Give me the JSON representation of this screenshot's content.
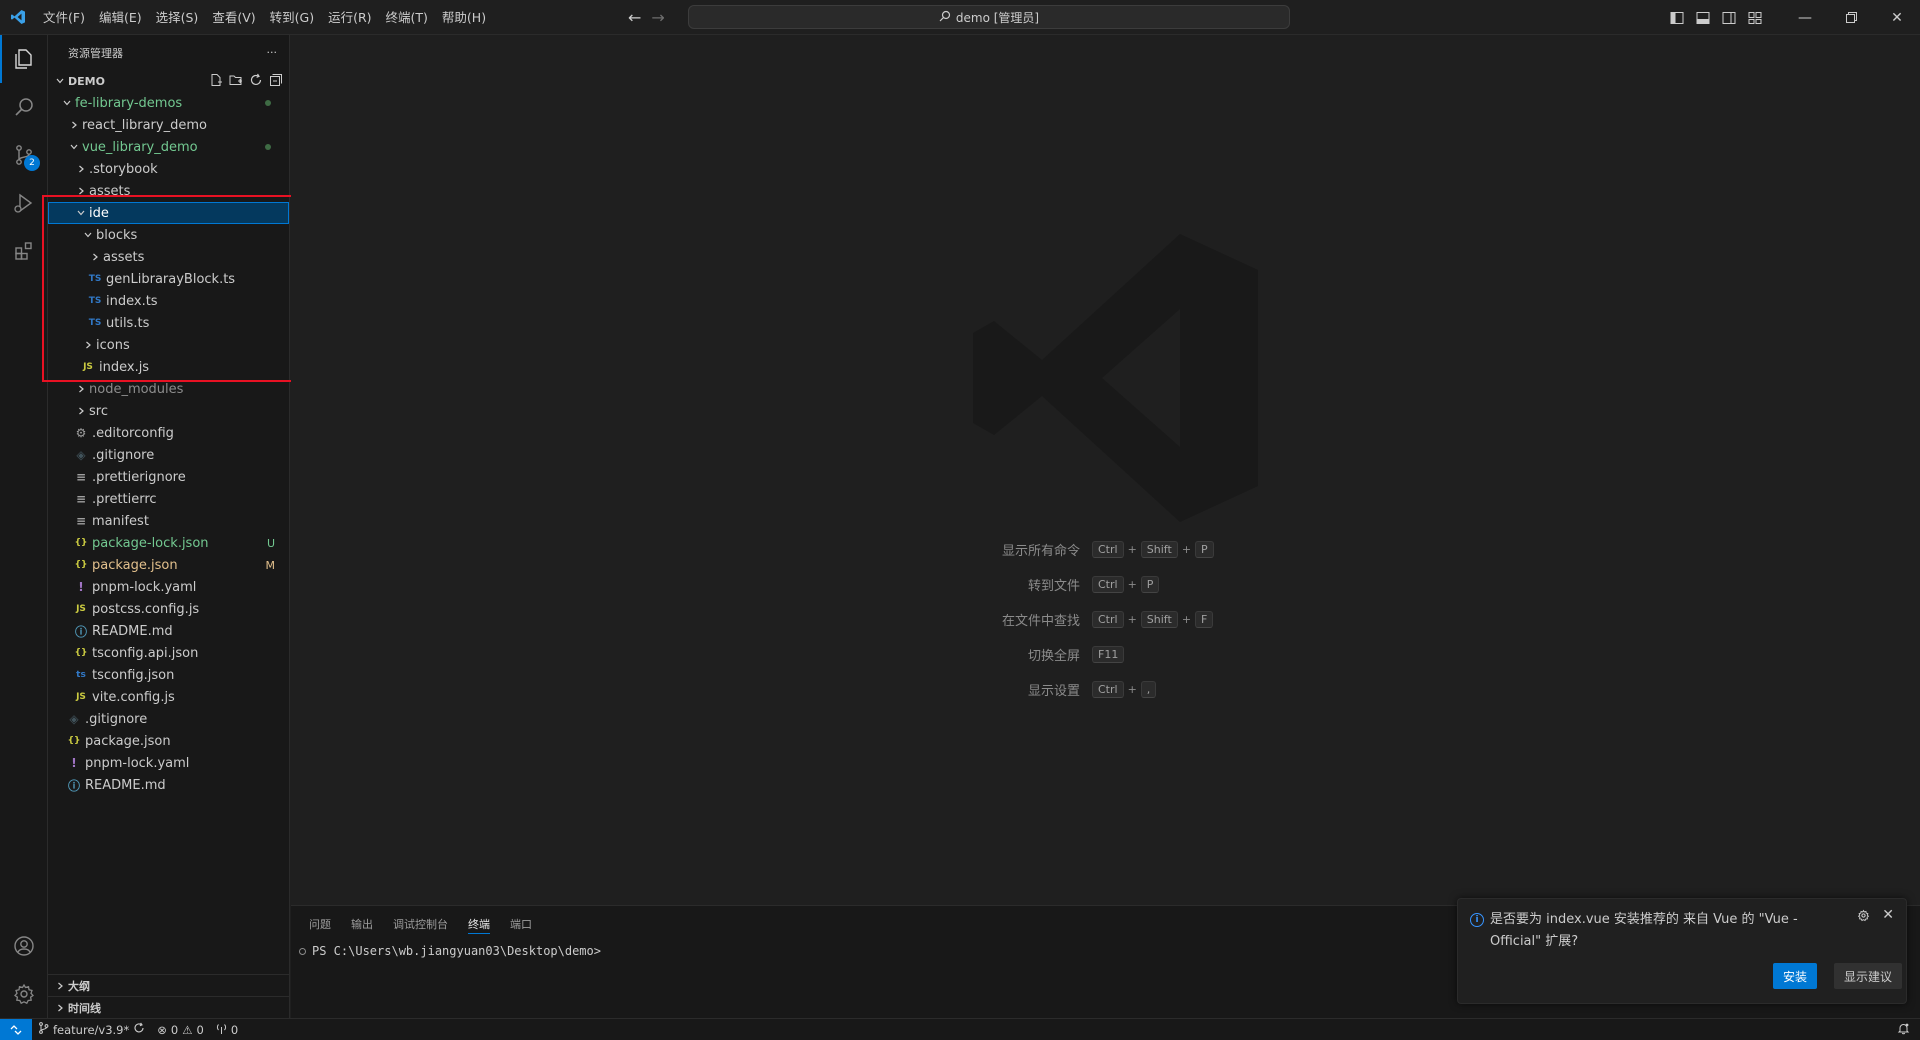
{
  "titlebar": {
    "menus": [
      "文件(F)",
      "编辑(E)",
      "选择(S)",
      "查看(V)",
      "转到(G)",
      "运行(R)",
      "终端(T)",
      "帮助(H)"
    ],
    "command_center": "demo [管理员]"
  },
  "activity": {
    "scm_badge": "2"
  },
  "sidebar": {
    "title": "资源管理器",
    "more": "···",
    "root": "DEMO",
    "tree": [
      {
        "label": "fe-library-demos",
        "indent": 1,
        "chev": "down",
        "icon": "",
        "color": "#73c991",
        "dot": true
      },
      {
        "label": "react_library_demo",
        "indent": 2,
        "chev": "right",
        "icon": "",
        "color": "#cccccc"
      },
      {
        "label": "vue_library_demo",
        "indent": 2,
        "chev": "down",
        "icon": "",
        "color": "#73c991",
        "dot": true
      },
      {
        "label": ".storybook",
        "indent": 3,
        "chev": "right",
        "icon": "",
        "color": "#cccccc"
      },
      {
        "label": "assets",
        "indent": 3,
        "chev": "right",
        "icon": "",
        "color": "#cccccc"
      },
      {
        "label": "ide",
        "indent": 3,
        "chev": "down",
        "icon": "",
        "color": "#ffffff",
        "selected": true
      },
      {
        "label": "blocks",
        "indent": 4,
        "chev": "down",
        "icon": "",
        "color": "#cccccc"
      },
      {
        "label": "assets",
        "indent": 5,
        "chev": "right",
        "icon": "",
        "color": "#cccccc"
      },
      {
        "label": "genLibrarayBlock.ts",
        "indent": 5,
        "chev": "",
        "icon": "TS",
        "iconColor": "#3178c6",
        "color": "#cccccc"
      },
      {
        "label": "index.ts",
        "indent": 5,
        "chev": "",
        "icon": "TS",
        "iconColor": "#3178c6",
        "color": "#cccccc"
      },
      {
        "label": "utils.ts",
        "indent": 5,
        "chev": "",
        "icon": "TS",
        "iconColor": "#3178c6",
        "color": "#cccccc"
      },
      {
        "label": "icons",
        "indent": 4,
        "chev": "right",
        "icon": "",
        "color": "#cccccc"
      },
      {
        "label": "index.js",
        "indent": 4,
        "chev": "",
        "icon": "JS",
        "iconColor": "#cbcb41",
        "color": "#cccccc"
      },
      {
        "label": "node_modules",
        "indent": 3,
        "chev": "right",
        "icon": "",
        "color": "#8c8c8c"
      },
      {
        "label": "src",
        "indent": 3,
        "chev": "right",
        "icon": "",
        "color": "#cccccc"
      },
      {
        "label": ".editorconfig",
        "indent": 3,
        "chev": "",
        "icon": "⚙",
        "iconColor": "#a0a0a0",
        "color": "#cccccc"
      },
      {
        "label": ".gitignore",
        "indent": 3,
        "chev": "",
        "icon": "◈",
        "iconColor": "#41535b",
        "color": "#cccccc"
      },
      {
        "label": ".prettierignore",
        "indent": 3,
        "chev": "",
        "icon": "≡",
        "iconColor": "#a0a0a0",
        "color": "#cccccc"
      },
      {
        "label": ".prettierrc",
        "indent": 3,
        "chev": "",
        "icon": "≡",
        "iconColor": "#a0a0a0",
        "color": "#cccccc"
      },
      {
        "label": "manifest",
        "indent": 3,
        "chev": "",
        "icon": "≡",
        "iconColor": "#a0a0a0",
        "color": "#cccccc"
      },
      {
        "label": "package-lock.json",
        "indent": 3,
        "chev": "",
        "icon": "{}",
        "iconColor": "#cbcb41",
        "color": "#73c991",
        "status": "U",
        "statusColor": "#73c991"
      },
      {
        "label": "package.json",
        "indent": 3,
        "chev": "",
        "icon": "{}",
        "iconColor": "#cbcb41",
        "color": "#e2c08d",
        "status": "M",
        "statusColor": "#e2c08d"
      },
      {
        "label": "pnpm-lock.yaml",
        "indent": 3,
        "chev": "",
        "icon": "!",
        "iconColor": "#a074c4",
        "color": "#cccccc"
      },
      {
        "label": "postcss.config.js",
        "indent": 3,
        "chev": "",
        "icon": "JS",
        "iconColor": "#cbcb41",
        "color": "#cccccc"
      },
      {
        "label": "README.md",
        "indent": 3,
        "chev": "",
        "icon": "ⓘ",
        "iconColor": "#519aba",
        "color": "#cccccc"
      },
      {
        "label": "tsconfig.api.json",
        "indent": 3,
        "chev": "",
        "icon": "{}",
        "iconColor": "#cbcb41",
        "color": "#cccccc"
      },
      {
        "label": "tsconfig.json",
        "indent": 3,
        "chev": "",
        "icon": "ts",
        "iconColor": "#3178c6",
        "color": "#cccccc"
      },
      {
        "label": "vite.config.js",
        "indent": 3,
        "chev": "",
        "icon": "JS",
        "iconColor": "#cbcb41",
        "color": "#cccccc"
      },
      {
        "label": ".gitignore",
        "indent": 2,
        "chev": "",
        "icon": "◈",
        "iconColor": "#41535b",
        "color": "#cccccc"
      },
      {
        "label": "package.json",
        "indent": 2,
        "chev": "",
        "icon": "{}",
        "iconColor": "#cbcb41",
        "color": "#cccccc"
      },
      {
        "label": "pnpm-lock.yaml",
        "indent": 2,
        "chev": "",
        "icon": "!",
        "iconColor": "#a074c4",
        "color": "#cccccc"
      },
      {
        "label": "README.md",
        "indent": 2,
        "chev": "",
        "icon": "ⓘ",
        "iconColor": "#519aba",
        "color": "#cccccc"
      }
    ],
    "outline": "大纲",
    "timeline": "时间线"
  },
  "editor": {
    "shortcuts": [
      {
        "label": "显示所有命令",
        "keys": [
          "Ctrl",
          "Shift",
          "P"
        ]
      },
      {
        "label": "转到文件",
        "keys": [
          "Ctrl",
          "P"
        ]
      },
      {
        "label": "在文件中查找",
        "keys": [
          "Ctrl",
          "Shift",
          "F"
        ]
      },
      {
        "label": "切换全屏",
        "keys": [
          "F11"
        ]
      },
      {
        "label": "显示设置",
        "keys": [
          "Ctrl",
          ","
        ]
      }
    ]
  },
  "panel": {
    "tabs": [
      "问题",
      "输出",
      "调试控制台",
      "终端",
      "端口"
    ],
    "active_tab": "终端",
    "terminal_line": "PS C:\\Users\\wb.jiangyuan03\\Desktop\\demo>"
  },
  "notification": {
    "message": "是否要为 index.vue 安装推荐的 来自 Vue 的 \"Vue - Official\" 扩展?",
    "install": "安装",
    "show_recommendations": "显示建议"
  },
  "statusbar": {
    "branch": "feature/v3.9*",
    "errors": "0",
    "warnings": "0",
    "ports": "0"
  }
}
